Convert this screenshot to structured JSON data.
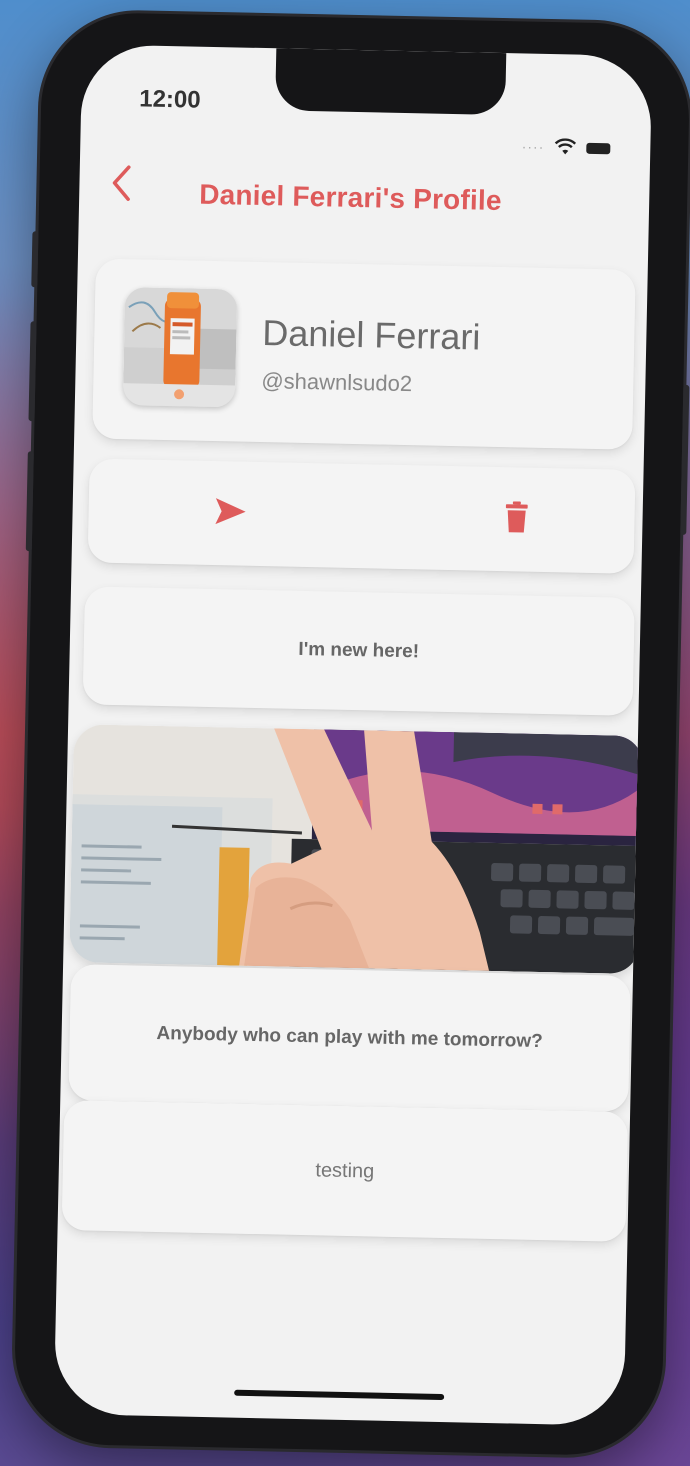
{
  "status_bar": {
    "time": "12:00",
    "signal": "····"
  },
  "header": {
    "title": "Daniel Ferrari's Profile",
    "back_icon": "chevron-left-icon"
  },
  "profile": {
    "name": "Daniel Ferrari",
    "handle": "@shawnlsudo2",
    "avatar_icon": "avatar-photo"
  },
  "actions": {
    "send_icon": "send-icon",
    "delete_icon": "trash-icon"
  },
  "posts": [
    {
      "text": "I'm new here!"
    },
    {
      "type": "image",
      "icon": "photo-peace-sign"
    },
    {
      "text": "Anybody who can play with me tomorrow?"
    },
    {
      "text": "testing"
    }
  ],
  "colors": {
    "accent": "#de5b5b",
    "screen_bg": "#f2f2f2",
    "card_bg": "#f4f4f4"
  }
}
